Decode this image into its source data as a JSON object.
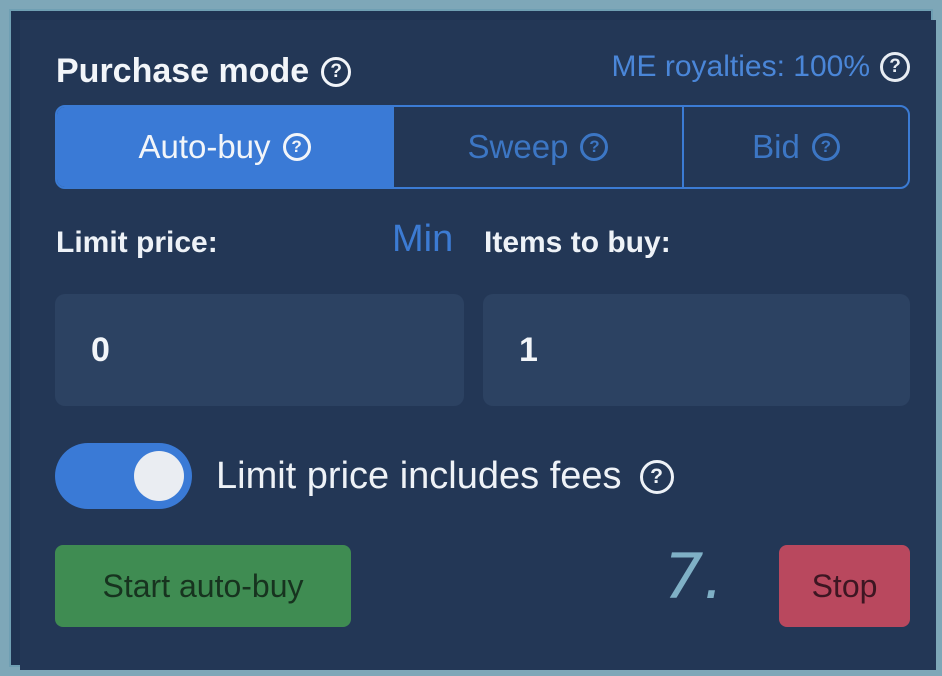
{
  "header": {
    "title": "Purchase mode",
    "royalties_label": "ME royalties: 100%",
    "help_glyph": "?"
  },
  "tabs": [
    {
      "label": "Auto-buy",
      "active": true
    },
    {
      "label": "Sweep",
      "active": false
    },
    {
      "label": "Bid",
      "active": false
    }
  ],
  "form": {
    "limit_price_label": "Limit price:",
    "min_link": "Min",
    "items_to_buy_label": "Items to buy:",
    "limit_price_value": "0",
    "items_to_buy_value": "1"
  },
  "toggle": {
    "label": "Limit price includes fees",
    "on": true
  },
  "actions": {
    "start_label": "Start auto-buy",
    "stop_label": "Stop"
  },
  "annotation": "7.",
  "colors": {
    "accent": "#3a7ad6",
    "start_button": "#3f8c52",
    "stop_button": "#b9485e",
    "background": "#233756"
  }
}
